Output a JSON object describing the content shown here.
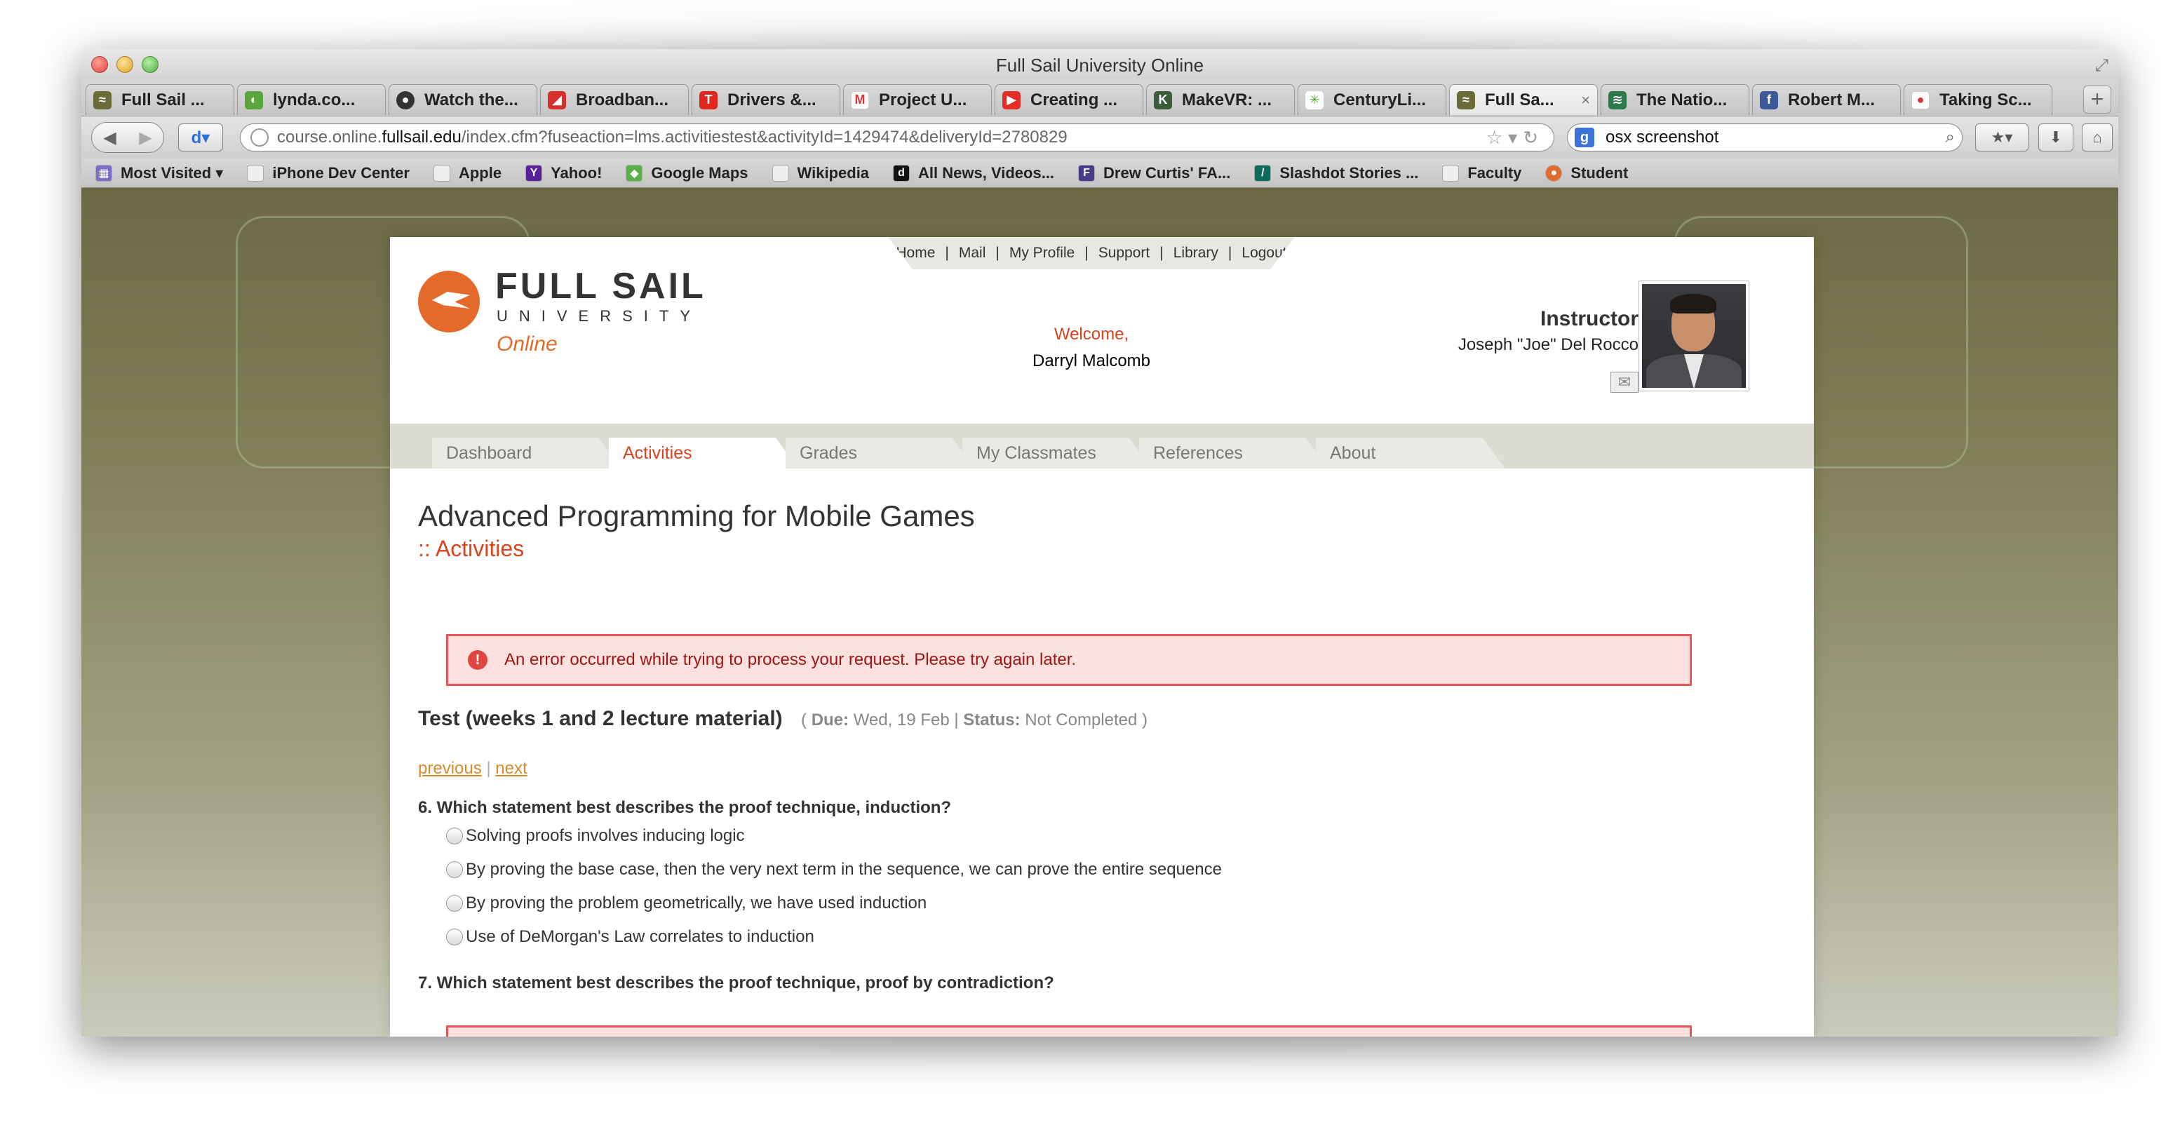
{
  "window": {
    "title": "Full Sail University Online"
  },
  "tabs": [
    {
      "label": "Full Sail ...",
      "icon": "fullsail-favicon",
      "active": false
    },
    {
      "label": "lynda.co...",
      "icon": "lynda-favicon",
      "active": false
    },
    {
      "label": "Watch the...",
      "icon": "globe-favicon",
      "active": false
    },
    {
      "label": "Broadban...",
      "icon": "broadband-favicon",
      "active": false
    },
    {
      "label": "Drivers &...",
      "icon": "t-favicon",
      "active": false
    },
    {
      "label": "Project U...",
      "icon": "gmail-favicon",
      "active": false
    },
    {
      "label": "Creating ...",
      "icon": "youtube-favicon",
      "active": false
    },
    {
      "label": "MakeVR: ...",
      "icon": "kickstarter-favicon",
      "active": false
    },
    {
      "label": "CenturyLi...",
      "icon": "centurylink-favicon",
      "active": false
    },
    {
      "label": "Full Sa...",
      "icon": "fullsail-favicon",
      "active": true
    },
    {
      "label": "The Natio...",
      "icon": "nation-favicon",
      "active": false
    },
    {
      "label": "Robert M...",
      "icon": "facebook-favicon",
      "active": false
    },
    {
      "label": "Taking Sc...",
      "icon": "apple-favicon",
      "active": false
    }
  ],
  "navbar": {
    "url_prefix": "course.online.",
    "url_domain": "fullsail.edu",
    "url_rest": "/index.cfm?fuseaction=lms.activitiestest&activityId=1429474&deliveryId=2780829",
    "search_value": "osx screenshot"
  },
  "bookmarks": [
    {
      "label": "Most Visited",
      "icon": "most-visited-icon"
    },
    {
      "label": "iPhone Dev Center",
      "icon": "page-icon"
    },
    {
      "label": "Apple",
      "icon": "page-icon"
    },
    {
      "label": "Yahoo!",
      "icon": "yahoo-icon"
    },
    {
      "label": "Google Maps",
      "icon": "google-maps-icon"
    },
    {
      "label": "Wikipedia",
      "icon": "page-icon"
    },
    {
      "label": "All News, Videos...",
      "icon": "digg-icon"
    },
    {
      "label": "Drew Curtis' FA...",
      "icon": "fark-icon"
    },
    {
      "label": "Slashdot Stories ...",
      "icon": "slashdot-icon"
    },
    {
      "label": "Faculty",
      "icon": "page-icon"
    },
    {
      "label": "Student",
      "icon": "fullsail-icon"
    }
  ],
  "site": {
    "topnav": [
      "Home",
      "Mail",
      "My Profile",
      "Support",
      "Library",
      "Logout"
    ],
    "logo": {
      "name": "FULL SAIL",
      "university": "UNIVERSITY",
      "online": "Online"
    },
    "welcome_label": "Welcome,",
    "user_name": "Darryl Malcomb",
    "instructor_label": "Instructor",
    "instructor_name": "Joseph \"Joe\" Del Rocco",
    "tabs": [
      "Dashboard",
      "Activities",
      "Grades",
      "My Classmates",
      "References",
      "About"
    ],
    "active_tab": "Activities"
  },
  "page": {
    "course_title": "Advanced Programming for Mobile Games",
    "section": ":: Activities",
    "error_message": "An error occurred while trying to process your request. Please try again later.",
    "test_title": "Test (weeks 1 and 2 lecture material)",
    "due_label": "Due:",
    "due_value": "Wed, 19 Feb",
    "status_label": "Status:",
    "status_value": "Not Completed",
    "previous": "previous",
    "next": "next",
    "questions": [
      {
        "text": "6. Which statement best describes the proof technique, induction?",
        "options": [
          "Solving proofs involves inducing logic",
          "By proving the base case, then the very next term in the sequence, we can prove the entire sequence",
          "By proving the problem geometrically, we have used induction",
          "Use of DeMorgan's Law correlates to induction"
        ]
      },
      {
        "text": "7. Which statement best describes the proof technique, proof by contradiction?",
        "options": []
      }
    ]
  },
  "colors": {
    "accent": "#d9431e",
    "logo_orange": "#e46a2c",
    "error_bg": "#fde1df",
    "error_border": "#e9555a",
    "link": "#d98b2b"
  }
}
